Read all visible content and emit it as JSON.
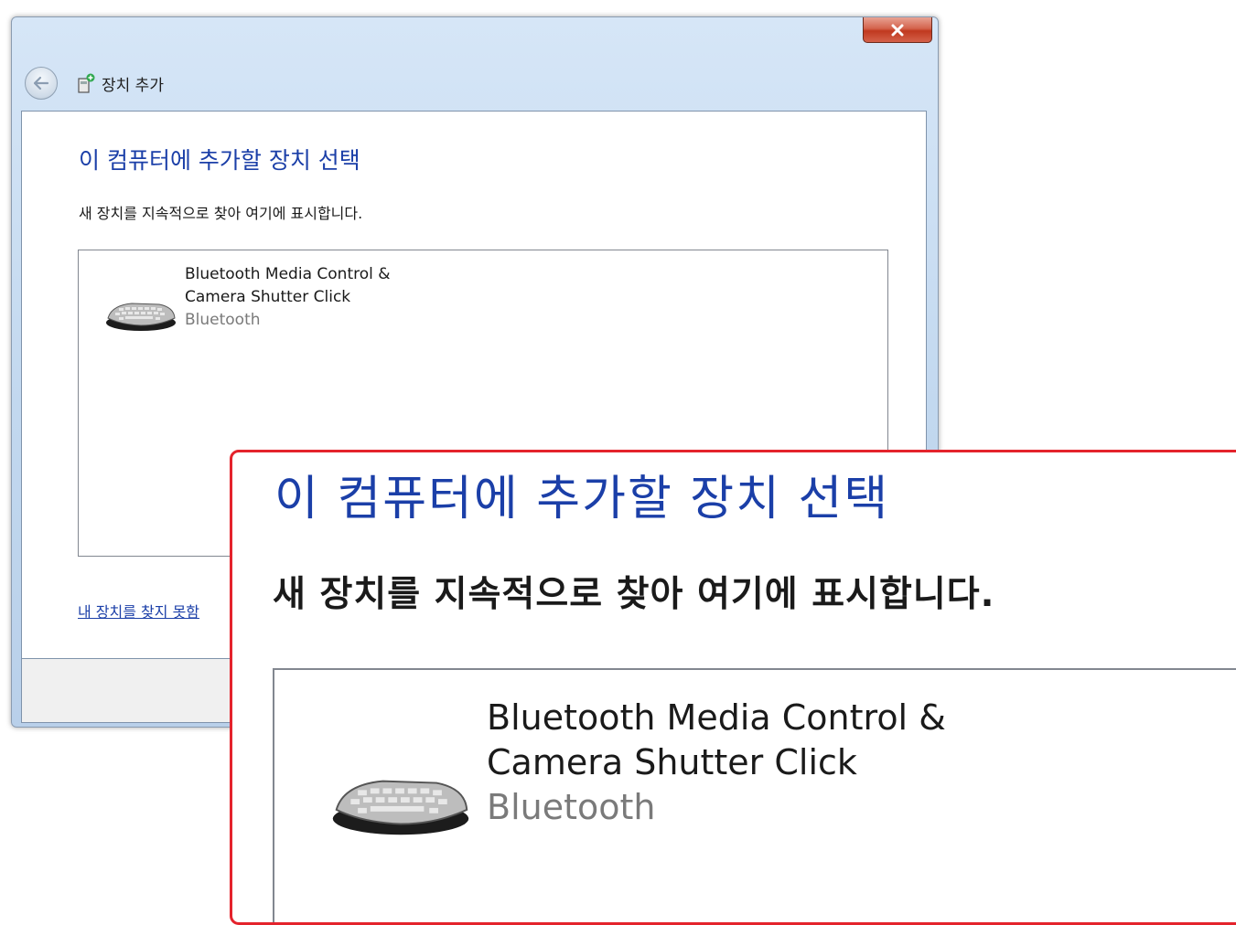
{
  "window": {
    "title": "장치 추가",
    "close_glyph": "✕",
    "back_icon": "back-arrow-icon",
    "title_icon": "add-device-icon"
  },
  "content": {
    "heading": "이 컴퓨터에 추가할 장치 선택",
    "subtext": "새 장치를 지속적으로 찾아 여기에 표시합니다.",
    "devices": [
      {
        "name_line1": "Bluetooth Media Control &",
        "name_line2": "Camera Shutter Click",
        "type": "Bluetooth",
        "icon": "keyboard-device-icon"
      }
    ],
    "help_link": "내 장치를 찾지 못함"
  },
  "zoom": {
    "heading": "이 컴퓨터에 추가할 장치 선택",
    "subtext": "새 장치를 지속적으로 찾아 여기에 표시합니다.",
    "device": {
      "name_line1": "Bluetooth Media Control &",
      "name_line2": "Camera Shutter Click",
      "type": "Bluetooth"
    },
    "highlight_color": "#e4232c"
  },
  "colors": {
    "heading_blue": "#1b3fa8",
    "window_frame": "#c2d8ef",
    "close_red": "#c0391f"
  }
}
